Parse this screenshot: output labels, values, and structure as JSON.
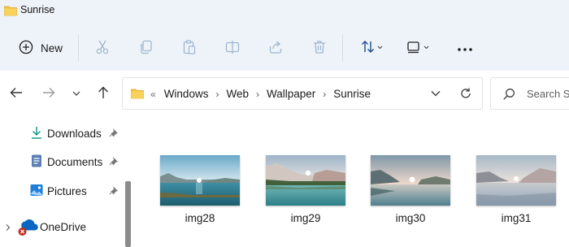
{
  "window": {
    "title": "Sunrise"
  },
  "toolbar": {
    "new_label": "New",
    "icons": [
      "cut-icon",
      "copy-icon",
      "paste-icon",
      "rename-icon",
      "share-icon",
      "delete-icon",
      "sort-icon",
      "view-icon",
      "more-icon"
    ]
  },
  "address": {
    "overflow_marker": "«",
    "crumbs": [
      "Windows",
      "Web",
      "Wallpaper",
      "Sunrise"
    ]
  },
  "search": {
    "placeholder": "Search Su"
  },
  "sidebar": {
    "items": [
      {
        "label": "Downloads",
        "pinned": true
      },
      {
        "label": "Documents",
        "pinned": true
      },
      {
        "label": "Pictures",
        "pinned": true
      },
      {
        "label": "OneDrive",
        "pinned": false
      }
    ]
  },
  "files": [
    {
      "name": "img28"
    },
    {
      "name": "img29"
    },
    {
      "name": "img30"
    },
    {
      "name": "img31"
    }
  ],
  "colors": {
    "chrome_bg": "#eef3f9",
    "folder_yellow": "#f3c33d",
    "accent_blue": "#0f6cbd",
    "onedrive_blue": "#0a66c2",
    "error_red": "#c42b1c"
  }
}
